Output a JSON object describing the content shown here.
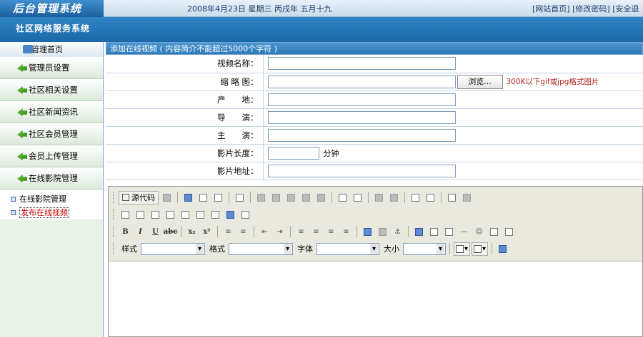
{
  "app": {
    "logo": "后台管理系统",
    "subtitle": "社区网络服务系统"
  },
  "header": {
    "date": "2008年4月23日 星期三 丙戌年 五月十九",
    "links": [
      "[网站首页]",
      "[修改密码]",
      "[安全退"
    ]
  },
  "sidebar": {
    "home": "管理首页",
    "menus": [
      "管理员设置",
      "社区相关设置",
      "社区新闻资讯",
      "社区会员管理",
      "会员上传管理",
      "在线影院管理"
    ],
    "subitems": [
      "在线影院管理",
      "发布在线视频"
    ]
  },
  "main": {
    "heading": "添加在线视频 ( 内容简介不能超过5000个字符 )",
    "form": {
      "name_label": "视频名称：",
      "thumb_label": "缩 略 图：",
      "browse": "浏览...",
      "thumb_hint": "300K以下gif或jpg格式图片",
      "origin_label": "产　　地：",
      "director_label": "导　　演：",
      "star_label": "主　　演：",
      "length_label": "影片长度：",
      "length_unit": "分钟",
      "url_label": "影片地址："
    },
    "editor": {
      "source_btn": "源代码",
      "style_label": "样式",
      "format_label": "格式",
      "font_label": "字体",
      "size_label": "大小"
    }
  }
}
